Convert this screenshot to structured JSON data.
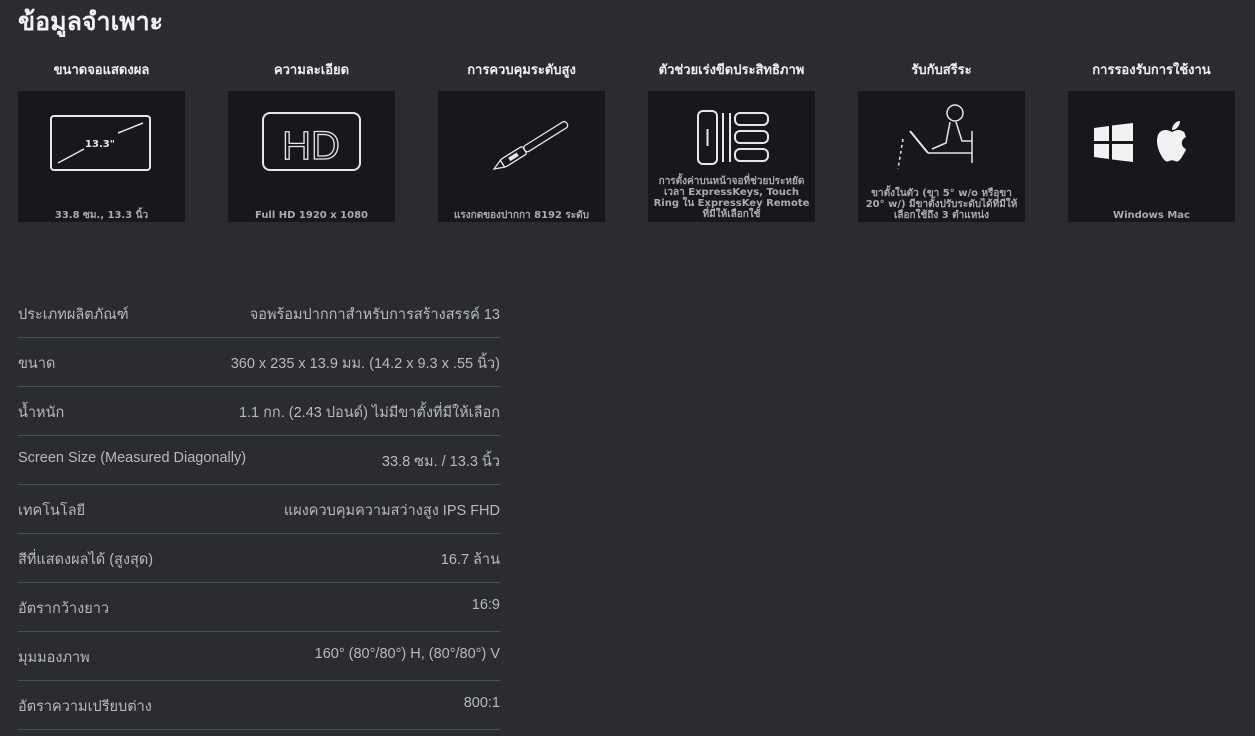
{
  "page": {
    "title": "ข้อมูลจำเพาะ"
  },
  "features": [
    {
      "title": "ขนาดจอแสดงผล",
      "caption": "33.8 ซม., 13.3 นิ้ว",
      "icon": "screen-size-icon",
      "icon_text": "13.3\""
    },
    {
      "title": "ความละเอียด",
      "caption": "Full HD 1920 x 1080",
      "icon": "hd-icon",
      "icon_text": "HD"
    },
    {
      "title": "การควบคุมระดับสูง",
      "caption": "แรงกดของปากกา 8192 ระดับ",
      "icon": "pen-icon"
    },
    {
      "title": "ตัวช่วยเร่งขีดประสิทธิภาพ",
      "caption": "การตั้งค่าบนหน้าจอที่ช่วยประหยัดเวลา ExpressKeys, Touch Ring ใน ExpressKey Remote ที่มีให้เลือกใช้",
      "icon": "expresskeys-icon"
    },
    {
      "title": "รับกับสรีระ",
      "caption": "ขาตั้งในตัว (ขา 5° w/o หรือขา 20° w/) มีขาตั้งปรับระดับได้ที่มีให้เลือกใช้ถึง 3 ตำแหน่ง",
      "icon": "ergonomic-user-icon"
    },
    {
      "title": "การรองรับการใช้งาน",
      "caption": "Windows Mac",
      "icon": "windows-apple-icon"
    }
  ],
  "specs": [
    {
      "label": "ประเภทผลิตภัณฑ์",
      "value": "จอพร้อมปากกาสำหรับการสร้างสรรค์ 13"
    },
    {
      "label": "ขนาด",
      "value": "360 x 235 x 13.9 มม. (14.2 x 9.3 x .55 นิ้ว)"
    },
    {
      "label": "น้ำหนัก",
      "value": "1.1 กก. (2.43 ปอนด์) ไม่มีขาตั้งที่มีให้เลือก"
    },
    {
      "label": "Screen Size (Measured Diagonally)",
      "value": "33.8 ซม. / 13.3 นิ้ว"
    },
    {
      "label": "เทคโนโลยี",
      "value": "แผงควบคุมความสว่างสูง IPS FHD"
    },
    {
      "label": "สีที่แสดงผลได้ (สูงสุด)",
      "value": "16.7 ล้าน"
    },
    {
      "label": "อัตรากว้างยาว",
      "value": "16:9"
    },
    {
      "label": "มุมมองภาพ",
      "value": "160° (80°/80°) H, (80°/80°) V"
    },
    {
      "label": "อัตราความเปรียบต่าง",
      "value": "800:1"
    }
  ],
  "colors": {
    "background": "#2a2c31",
    "tile": "#17181b",
    "divider": "#4b4e54",
    "text": "#b7b9bd"
  }
}
